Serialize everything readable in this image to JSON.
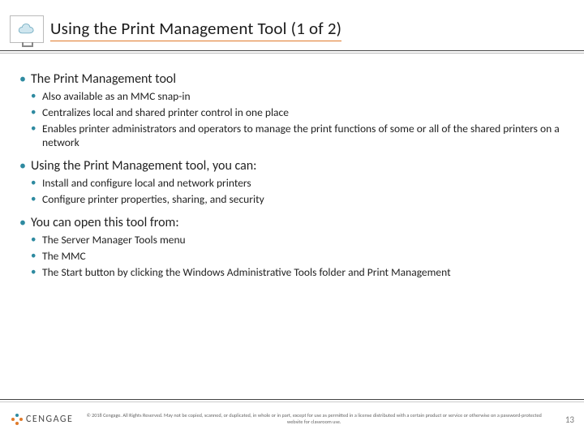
{
  "title": "Using the Print Management Tool (1 of 2)",
  "icon": "cloud-icon",
  "bullets": [
    {
      "text": "The Print Management tool",
      "sub": [
        "Also available as an MMC snap-in",
        "Centralizes local and shared printer control in one place",
        "Enables printer administrators and operators to manage the print functions of some or all of the shared printers on a network"
      ]
    },
    {
      "text": "Using the Print Management tool, you can:",
      "sub": [
        "Install and configure local and network printers",
        "Configure printer properties, sharing, and security"
      ]
    },
    {
      "text": "You can open this tool from:",
      "sub": [
        "The Server Manager Tools menu",
        "The MMC",
        "The Start button by clicking the Windows Administrative Tools folder and Print Management"
      ]
    }
  ],
  "footer": {
    "brand": "CENGAGE",
    "copyright": "© 2018 Cengage. All Rights Reserved. May not be copied, scanned, or duplicated, in whole or in part, except for use as permitted in a license distributed with a certain product or service or otherwise on a password-protected website for classroom use.",
    "page": "13"
  }
}
